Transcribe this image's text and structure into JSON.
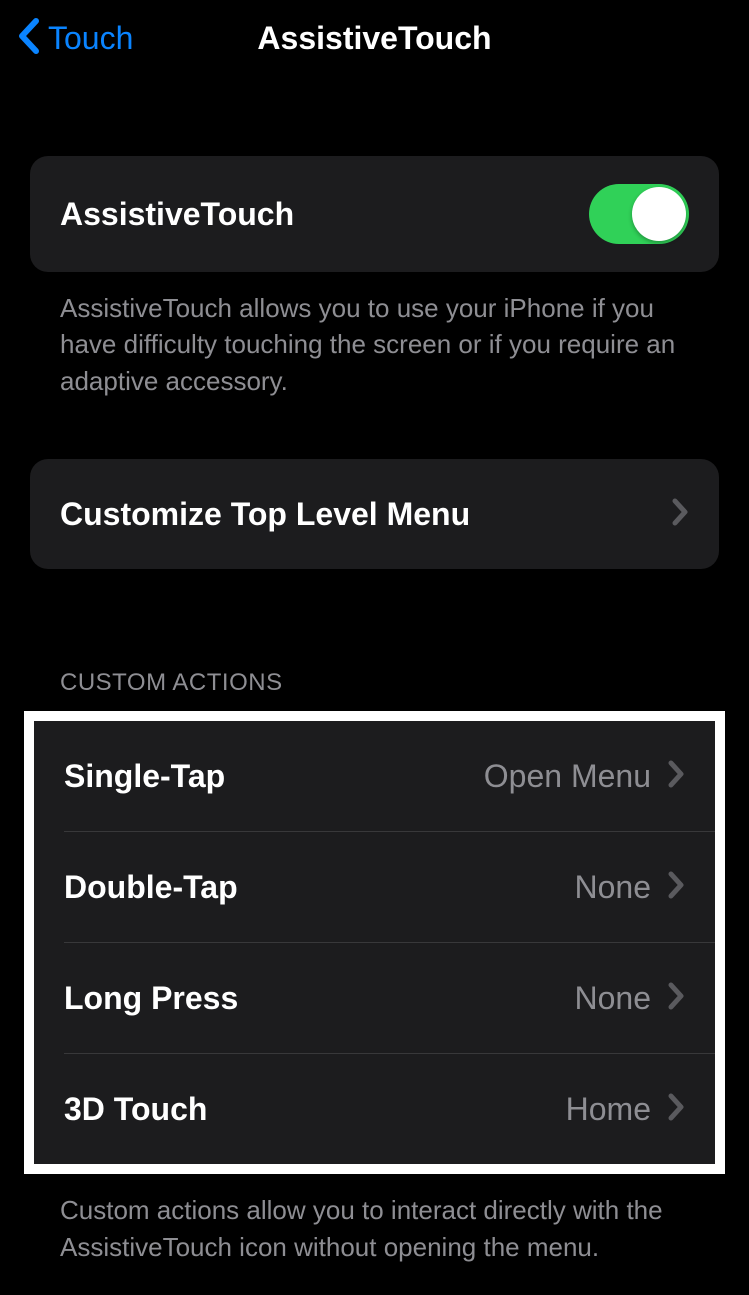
{
  "nav": {
    "back_label": "Touch",
    "title": "AssistiveTouch"
  },
  "main_toggle": {
    "label": "AssistiveTouch",
    "enabled": true,
    "footer": "AssistiveTouch allows you to use your iPhone if you have difficulty touching the screen or if you require an adaptive accessory."
  },
  "customize_menu": {
    "label": "Customize Top Level Menu"
  },
  "custom_actions": {
    "header": "CUSTOM ACTIONS",
    "items": [
      {
        "label": "Single-Tap",
        "value": "Open Menu"
      },
      {
        "label": "Double-Tap",
        "value": "None"
      },
      {
        "label": "Long Press",
        "value": "None"
      },
      {
        "label": "3D Touch",
        "value": "Home"
      }
    ],
    "footer": "Custom actions allow you to interact directly with the AssistiveTouch icon without opening the menu."
  }
}
